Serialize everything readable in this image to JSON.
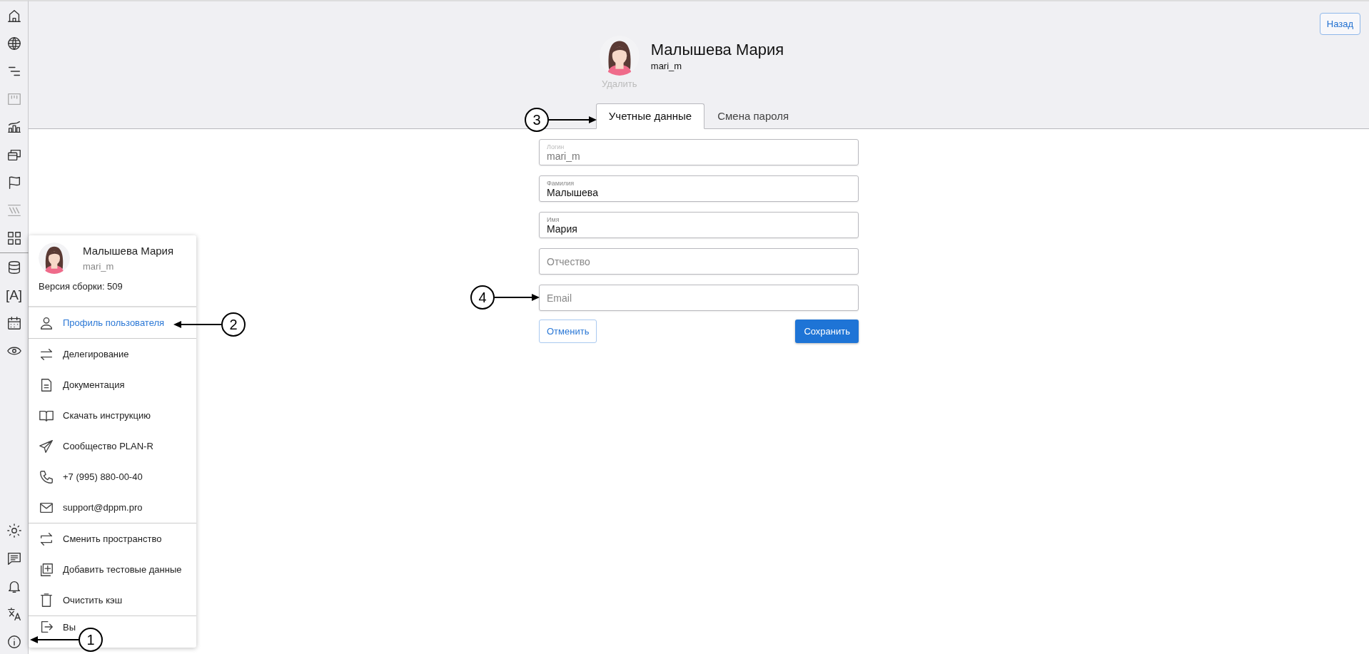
{
  "sidebar": {
    "text_icon": "[A]"
  },
  "header": {
    "back_button": "Назад",
    "name": "Малышева Мария",
    "login": "mari_m",
    "delete_link": "Удалить"
  },
  "tabs": [
    {
      "label": "Учетные данные",
      "selected": true
    },
    {
      "label": "Смена пароля",
      "selected": false
    }
  ],
  "form": {
    "fields": [
      {
        "label": "Логин",
        "value": "mari_m",
        "disabled": true
      },
      {
        "label": "Фамилия",
        "value": "Малышева",
        "disabled": false
      },
      {
        "label": "Имя",
        "value": "Мария",
        "disabled": false
      },
      {
        "placeholder": "Отчество",
        "disabled": false
      },
      {
        "placeholder": "Email",
        "disabled": false
      }
    ],
    "cancel_button": "Отменить",
    "save_button": "Сохранить"
  },
  "user_menu": {
    "name": "Малышева Мария",
    "login": "mari_m",
    "version": "Версия сборки: 509",
    "groups": [
      [
        {
          "label": "Профиль пользователя",
          "selected": true
        }
      ],
      [
        {
          "label": "Делегирование",
          "selected": false
        },
        {
          "label": "Документация",
          "selected": false
        },
        {
          "label": "Скачать инструкцию",
          "selected": false
        },
        {
          "label": "Сообщество PLAN-R",
          "selected": false
        },
        {
          "label": "+7 (995) 880-00-40",
          "selected": false
        },
        {
          "label": "support@dppm.pro",
          "selected": false
        }
      ],
      [
        {
          "label": "Сменить пространство",
          "selected": false
        },
        {
          "label": "Добавить тестовые данные",
          "selected": false
        },
        {
          "label": "Очистить кэш",
          "selected": false
        }
      ],
      [
        {
          "label": "Вы",
          "selected": false
        }
      ]
    ]
  },
  "callouts": [
    {
      "label": "1"
    },
    {
      "label": "2"
    },
    {
      "label": "3"
    },
    {
      "label": "4"
    }
  ]
}
